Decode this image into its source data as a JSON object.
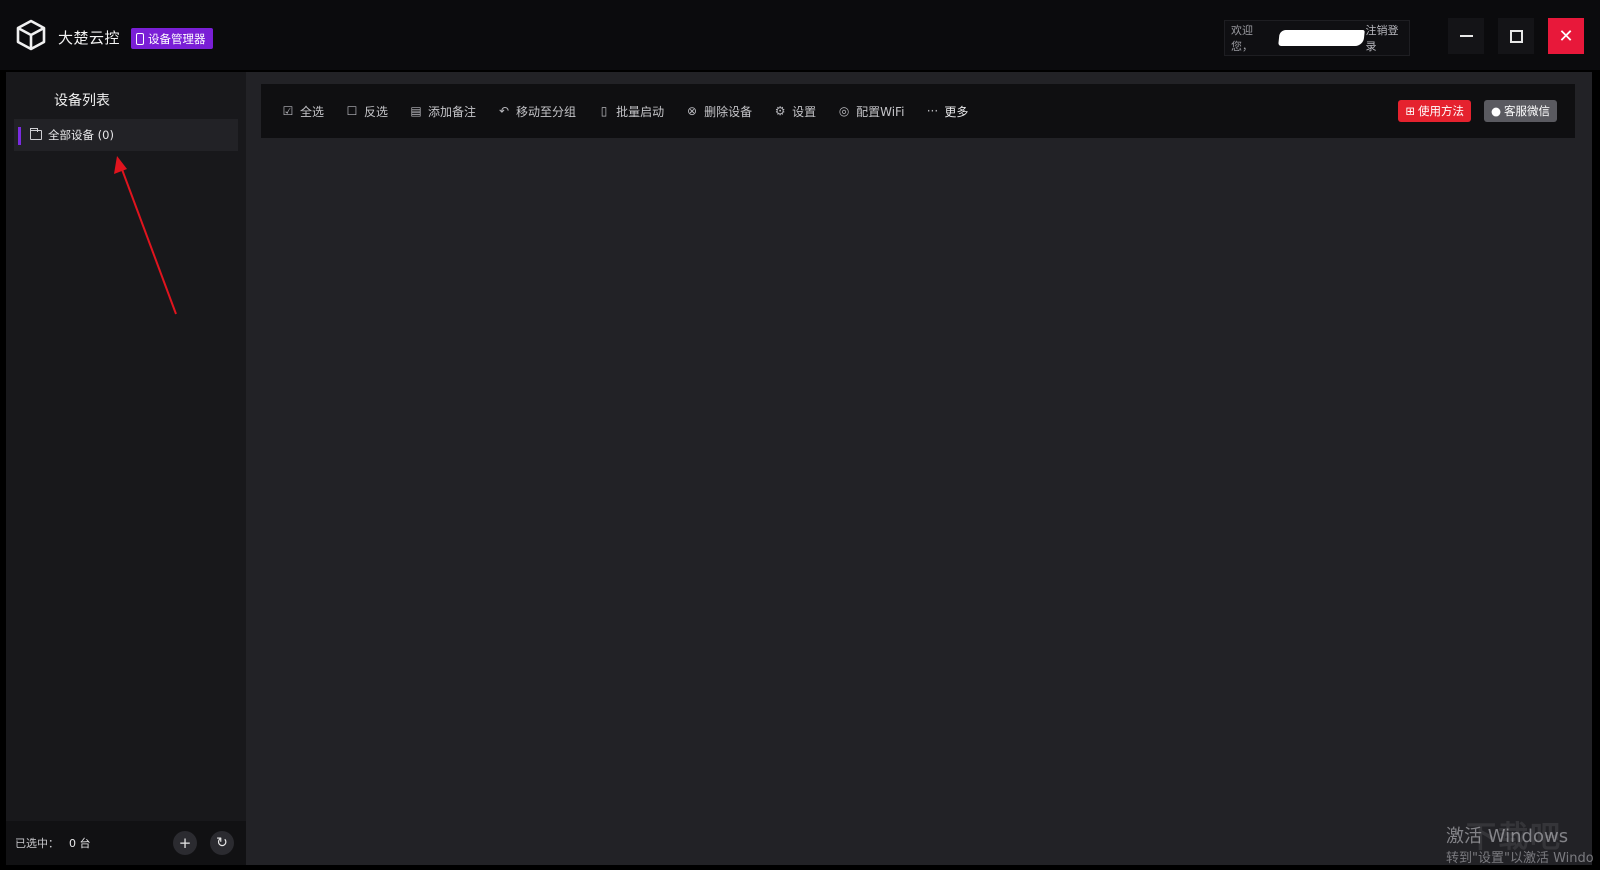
{
  "app": {
    "name": "大楚云控",
    "badge": "设备管理器"
  },
  "user": {
    "welcome": "欢迎您，",
    "logout": "注销登录"
  },
  "sidebar": {
    "title": "设备列表",
    "items": [
      {
        "label": "全部设备 (0)"
      }
    ],
    "footer": {
      "selected_label": "已选中：",
      "selected_count": "0 台"
    }
  },
  "toolbar": {
    "items": [
      {
        "label": "全选",
        "icon": "checkbox-filled-icon"
      },
      {
        "label": "反选",
        "icon": "checkbox-outline-icon"
      },
      {
        "label": "添加备注",
        "icon": "note-icon"
      },
      {
        "label": "移动至分组",
        "icon": "move-icon"
      },
      {
        "label": "批量启动",
        "icon": "phone-icon"
      },
      {
        "label": "删除设备",
        "icon": "delete-icon"
      },
      {
        "label": "设置",
        "icon": "gear-icon"
      },
      {
        "label": "配置WiFi",
        "icon": "wifi-icon"
      },
      {
        "label": "更多",
        "icon": "more-icon"
      }
    ],
    "help_label": "使用方法",
    "wechat_label": "客服微信"
  },
  "watermark": {
    "line1": "激活 Windows",
    "line2": "转到\"设置\"以激活 Windo",
    "site": "下载吧"
  },
  "colors": {
    "accent_purple": "#7a1fd6",
    "close_red": "#e8183a",
    "help_red": "#e5222e"
  }
}
